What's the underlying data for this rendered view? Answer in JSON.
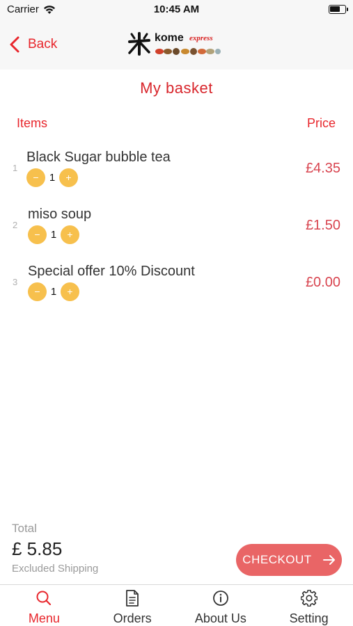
{
  "status_bar": {
    "carrier": "Carrier",
    "time": "10:45 AM"
  },
  "nav": {
    "back_label": "Back",
    "logo_brand": "kome",
    "logo_tag": "express"
  },
  "page": {
    "title": "My basket"
  },
  "columns": {
    "items": "Items",
    "price": "Price"
  },
  "basket": {
    "items": [
      {
        "index": "1",
        "name": "Black Sugar bubble tea",
        "quantity": "1",
        "price": "£4.35"
      },
      {
        "index": "2",
        "name": "miso soup",
        "quantity": "1",
        "price": "£1.50"
      },
      {
        "index": "3",
        "name": "Special offer 10% Discount",
        "quantity": "1",
        "price": "£0.00"
      }
    ]
  },
  "summary": {
    "total_label": "Total",
    "total_value": "£ 5.85",
    "shipping_note": "Excluded Shipping",
    "checkout_label": "CHECKOUT"
  },
  "tabs": [
    {
      "label": "Menu",
      "icon": "search-icon",
      "active": true
    },
    {
      "label": "Orders",
      "icon": "document-icon",
      "active": false
    },
    {
      "label": "About Us",
      "icon": "info-icon",
      "active": false
    },
    {
      "label": "Setting",
      "icon": "gear-icon",
      "active": false
    }
  ],
  "colors": {
    "accent": "#e8262c",
    "price": "#d8444f",
    "qty_button": "#f7c04d",
    "checkout": "#e96566",
    "bar_bg": "#f7f7f7"
  }
}
